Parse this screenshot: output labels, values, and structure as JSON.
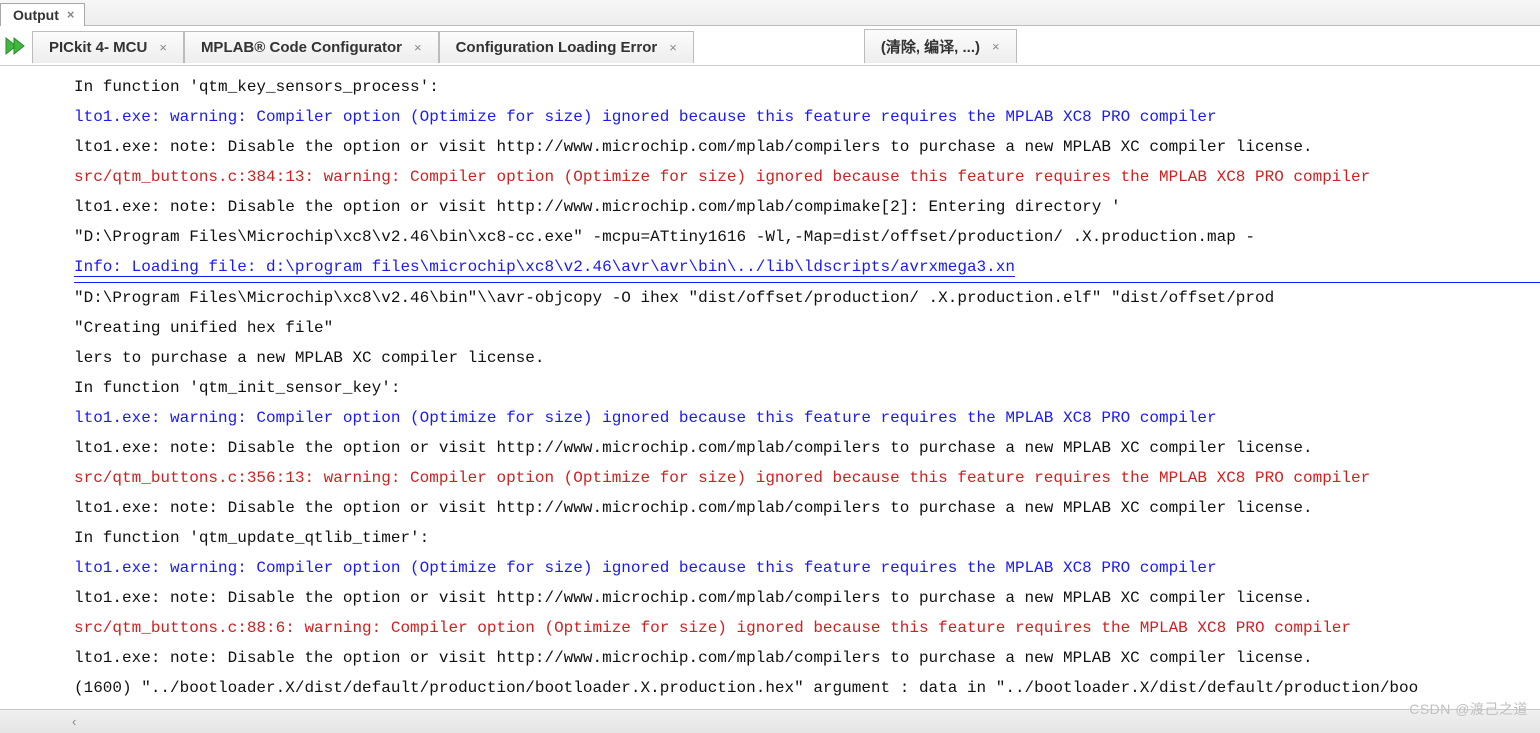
{
  "panel": {
    "title": "Output"
  },
  "tabs": [
    {
      "label": "PICkit 4-            MCU"
    },
    {
      "label": "MPLAB® Code Configurator"
    },
    {
      "label": "Configuration Loading Error"
    },
    {
      "label": "(清除, 编译, ...)"
    }
  ],
  "watermark": "CSDN @渡己之道",
  "lines": [
    {
      "cls": "",
      "text": "In function 'qtm_key_sensors_process':"
    },
    {
      "cls": "blue",
      "text": "lto1.exe: warning: Compiler option (Optimize for size) ignored because this feature requires the MPLAB XC8 PRO compiler"
    },
    {
      "cls": "",
      "text": "lto1.exe: note: Disable the option or visit http://www.microchip.com/mplab/compilers to purchase a new MPLAB XC compiler license."
    },
    {
      "cls": "red",
      "text": "src/qtm_buttons.c:384:13: warning: Compiler option (Optimize for size) ignored because this feature requires the MPLAB XC8 PRO compiler"
    },
    {
      "cls": "",
      "text": "lto1.exe: note: Disable the option or visit http://www.microchip.com/mplab/compimake[2]: Entering directory '"
    },
    {
      "cls": "",
      "text": "\"D:\\Program Files\\Microchip\\xc8\\v2.46\\bin\\xc8-cc.exe\"  -mcpu=ATtiny1616 -Wl,-Map=dist/offset/production/               .X.production.map  -"
    },
    {
      "cls": "link",
      "text": "Info: Loading file: d:\\program files\\microchip\\xc8\\v2.46\\avr\\avr\\bin\\../lib\\ldscripts/avrxmega3.xn"
    },
    {
      "cls": "",
      "text": "\"D:\\Program Files\\Microchip\\xc8\\v2.46\\bin\"\\\\avr-objcopy -O ihex \"dist/offset/production/                     .X.production.elf\" \"dist/offset/prod"
    },
    {
      "cls": "",
      "text": "\"Creating unified hex file\""
    },
    {
      "cls": "",
      "text": "lers to purchase a new MPLAB XC compiler license."
    },
    {
      "cls": "",
      "text": "In function 'qtm_init_sensor_key':"
    },
    {
      "cls": "blue",
      "text": "lto1.exe: warning: Compiler option (Optimize for size) ignored because this feature requires the MPLAB XC8 PRO compiler"
    },
    {
      "cls": "",
      "text": "lto1.exe: note: Disable the option or visit http://www.microchip.com/mplab/compilers to purchase a new MPLAB XC compiler license."
    },
    {
      "cls": "red",
      "text": "src/qtm_buttons.c:356:13: warning: Compiler option (Optimize for size) ignored because this feature requires the MPLAB XC8 PRO compiler"
    },
    {
      "cls": "",
      "text": "lto1.exe: note: Disable the option or visit http://www.microchip.com/mplab/compilers to purchase a new MPLAB XC compiler license."
    },
    {
      "cls": "",
      "text": "In function 'qtm_update_qtlib_timer':"
    },
    {
      "cls": "blue",
      "text": "lto1.exe: warning: Compiler option (Optimize for size) ignored because this feature requires the MPLAB XC8 PRO compiler"
    },
    {
      "cls": "",
      "text": "lto1.exe: note: Disable the option or visit http://www.microchip.com/mplab/compilers to purchase a new MPLAB XC compiler license."
    },
    {
      "cls": "red",
      "text": "src/qtm_buttons.c:88:6: warning: Compiler option (Optimize for size) ignored because this feature requires the MPLAB XC8 PRO compiler"
    },
    {
      "cls": "",
      "text": "lto1.exe: note: Disable the option or visit http://www.microchip.com/mplab/compilers to purchase a new MPLAB XC compiler license."
    },
    {
      "cls": "",
      "text": "(1600) \"../bootloader.X/dist/default/production/bootloader.X.production.hex\" argument : data in \"../bootloader.X/dist/default/production/boo"
    }
  ]
}
